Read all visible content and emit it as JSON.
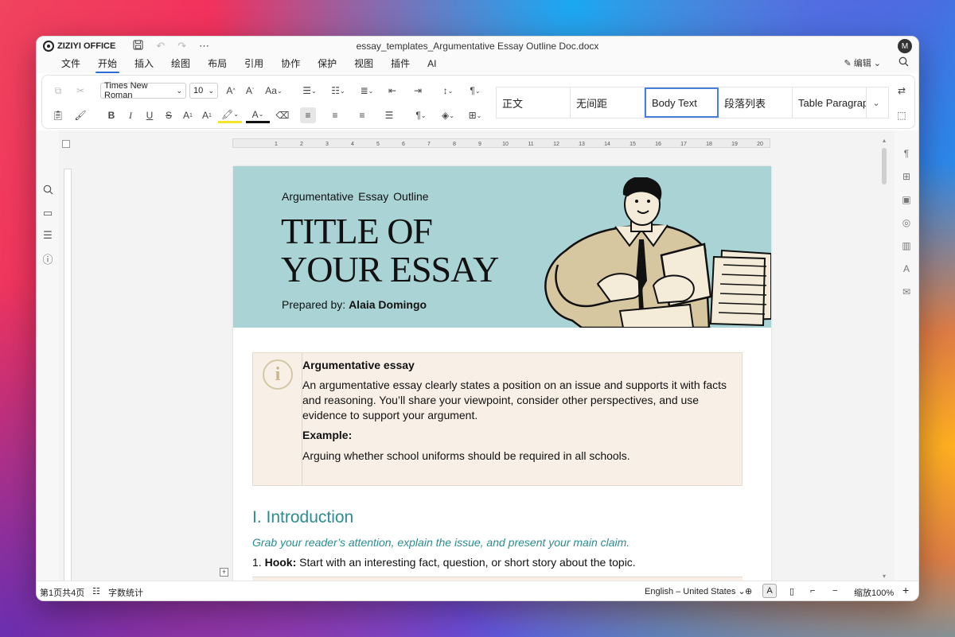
{
  "app": {
    "name": "ZIZIYI OFFICE",
    "document_title": "essay_templates_Argumentative Essay Outline Doc.docx",
    "avatar_initial": "M"
  },
  "menu": {
    "items": [
      "文件",
      "开始",
      "插入",
      "绘图",
      "布局",
      "引用",
      "协作",
      "保护",
      "视图",
      "插件",
      "AI"
    ],
    "active": "开始",
    "edit_label": "编辑"
  },
  "ribbon": {
    "font_family": "Times New Roman",
    "font_size": "10",
    "styles": [
      "正文",
      "无间距",
      "Body Text",
      "段落列表",
      "Table Paragrap"
    ],
    "selected_style": "Body Text"
  },
  "ruler": {
    "ticks": [
      "1",
      "2",
      "3",
      "4",
      "5",
      "6",
      "7",
      "8",
      "9",
      "10",
      "11",
      "12",
      "13",
      "14",
      "15",
      "16",
      "17",
      "18",
      "19",
      "20"
    ]
  },
  "document": {
    "banner": {
      "subtitle": "Argumentative  Essay  Outline",
      "title_line1": "TITLE OF",
      "title_line2": "YOUR ESSAY",
      "prepared_label": "Prepared by:",
      "prepared_name": "Alaia Domingo",
      "background_color": "#a9d3d5"
    },
    "callout": {
      "heading": "Argumentative essay",
      "body": "An argumentative essay clearly states a position on an issue and supports it with facts and reasoning. You’ll share your viewpoint, consider other perspectives, and use evidence to support your argument.",
      "example_label": "Example:",
      "example_text": "Arguing whether school uniforms should be required in all schools.",
      "icon": "info-icon"
    },
    "section": {
      "heading": "I. Introduction",
      "instruction": "Grab your reader’s attention, explain the issue, and present your main claim.",
      "item_number": "1.",
      "item_label": "Hook:",
      "item_text": " Start with an interesting fact, question, or short story about the topic."
    },
    "accent_color": "#2c8c90"
  },
  "status": {
    "page_info": "第1页共4页",
    "word_count": "字数统计",
    "language": "English – United States",
    "zoom": "缩放100%"
  }
}
